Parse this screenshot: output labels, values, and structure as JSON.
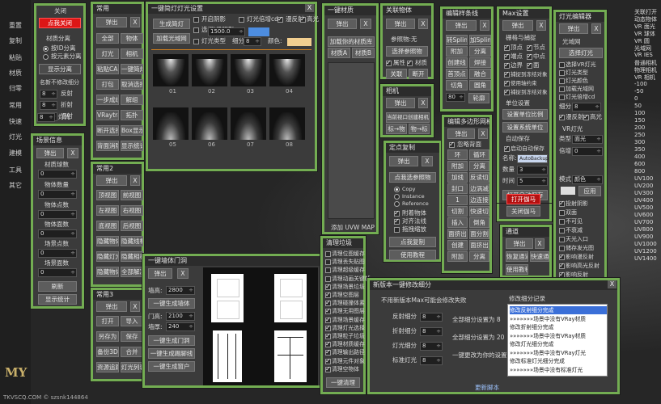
{
  "sidebar": {
    "items": [
      "重置",
      "复制",
      "粘贴",
      "材质",
      "归零",
      "常用",
      "快速",
      "灯光",
      "建模",
      "工具",
      "其它"
    ],
    "logo": "MY",
    "footer": "TKVSCQ.COM © szsnk144864"
  },
  "p_off": {
    "close": "关闭",
    "red": "点我关闭",
    "mat_sep": "材质分离",
    "r1": "按ID分离",
    "r2": "按元素分离",
    "s1": "显示分离",
    "rename": "名新不修改细分",
    "refl": "反射",
    "refr": "折射",
    "fx": "灯光",
    "fy": "漫射",
    "spins": [
      "8",
      "8",
      "8",
      "8"
    ]
  },
  "scene": {
    "title": "场景信息",
    "popup": "弹出",
    "labels": [
      "材质球数",
      "物体数量",
      "物体点数",
      "物体面数",
      "场景点数",
      "场景面数"
    ],
    "values": [
      "0",
      "0",
      "0",
      "0",
      "0",
      "0"
    ],
    "refresh": "刷新",
    "stats": "显示统计"
  },
  "common": {
    "title": "常用",
    "popup": "弹出",
    "btns": [
      "全部",
      "物体",
      "灯光",
      "相机",
      "粘贴CAD",
      "一键简灯",
      "打包",
      "取消选择",
      "一步成组",
      "解组",
      "VRaytrao",
      "拓扑",
      "断开选择",
      "Box显示",
      "背面消隐",
      "显示统计"
    ]
  },
  "common2": {
    "title": "常用2",
    "popup": "弹出",
    "btns": [
      "顶视图",
      "前视图",
      "左视图",
      "右视图",
      "底视图",
      "后视图",
      "隐藏物体",
      "隐藏线框",
      "隐藏灯光",
      "隐藏相机",
      "隐藏物体",
      "全部解冻"
    ]
  },
  "common3": {
    "title": "常用3",
    "popup": "弹出",
    "btns": [
      "打开",
      "导入",
      "另存为",
      "保存",
      "备份3D",
      "合并",
      "资源追踪",
      "灯光列表"
    ]
  },
  "light": {
    "title": "一键简灯灯光设置",
    "gen": "生成简灯",
    "load": "加载光域网",
    "c1": "开启阴影",
    "c2": "选择VR阴影",
    "c3": "灯光倍增cd",
    "c4": "漫反射",
    "c5": "高光",
    "intensity": "1500.0",
    "type": "灯光类型",
    "sub": "细分",
    "subval": "8",
    "color": "颜色:",
    "thumbs": [
      "01",
      "02",
      "03",
      "04",
      "05",
      "06",
      "07",
      "08"
    ]
  },
  "door": {
    "title": "一键墙体门洞",
    "popup": "弹出",
    "w": "墙高:",
    "wv": "2800",
    "gen": "一键生成墙体",
    "dh": "门高:",
    "dhv": "2100",
    "dt": "墙厚:",
    "dtv": "240",
    "b1": "一键生成门洞",
    "b2": "一键生成踢脚线",
    "b3": "一键生成窗户"
  },
  "mat": {
    "title": "一键材质",
    "popup": "弹出",
    "load": "加载你的材质库",
    "a": "材质A",
    "b": "材质B",
    "uvw": "添加 UVW MAP"
  },
  "link": {
    "title": "关联物体",
    "popup": "弹出",
    "ref": "参照物:无",
    "sel": "选择参照物",
    "c1": "属性",
    "c2": "材质",
    "rel": "关联",
    "brk": "断开"
  },
  "cam": {
    "title": "相机",
    "popup": "弹出",
    "cur": "当前视口创建相机",
    "tgt": "标→物",
    "obj": "物→标"
  },
  "copy": {
    "title": "定点复制",
    "popup": "弹出",
    "pick": "点我选参照物",
    "r1": "Copy",
    "r2": "Instance",
    "r3": "Reference",
    "c1": "附着物体",
    "c2": "对齐法线",
    "c3": "拖拽缩放",
    "paste": "点我复制",
    "guide": "使用教程"
  },
  "spline": {
    "title": "编辑样条线",
    "popup": "弹出",
    "b": [
      "转Spline",
      "加Spline",
      "附加",
      "分离",
      "创建线",
      "焊接",
      "首顶点",
      "融合",
      "切角",
      "圆角"
    ],
    "v1": "80",
    "contour": "轮廓"
  },
  "poly": {
    "title": "编辑多边形网格",
    "popup": "弹出",
    "c1": "忽略背面",
    "b": [
      "环",
      "循环",
      "附加",
      "分离",
      "加线",
      "反读切线",
      "封口",
      "边涡减",
      "1",
      "边连接",
      "切割",
      "快速切",
      "插入",
      "倒角",
      "面挤出",
      "面分割",
      "创建",
      "面挤出",
      "附加",
      "分离"
    ]
  },
  "max": {
    "title": "Max设置",
    "popup": "弹出",
    "grid": "栅格与捕捉",
    "c": [
      "顶点",
      "节点",
      "端点",
      "中点",
      "边界",
      "面"
    ],
    "c3": "捕捉到冻结对象",
    "c4": "使用轴约束",
    "c5": "捕捉到冻结对象",
    "unit": "单位设置",
    "unit1": "设置单位比例",
    "unit2": "设置系统单位",
    "save": "自动保存",
    "c6": "启动自动保存",
    "name": "名称:",
    "nameval": "AutoBackup",
    "cnt": "数量",
    "cntv": "3",
    "time": "时间",
    "timev": "5",
    "open": "打开自动保存",
    "gamma": "伽马",
    "g1": "打开伽马",
    "g2": "关闭伽马"
  },
  "lighted": {
    "title": "灯光编辑器",
    "popup": "弹出",
    "domain": "光域网",
    "b1": "选择灯光",
    "c": [
      "选择VR灯光",
      "灯光类型",
      "灯光颜色",
      "加载光域网",
      "灯光倍增cd"
    ],
    "sub": "细分",
    "subv": "8",
    "diff": "漫反射",
    "spec": "高光",
    "vr": "VR灯光",
    "type": "类型",
    "typev": "面光",
    "mul": "倍增",
    "mulv": "0",
    "mode": "模式",
    "modev": "颜色",
    "apply": "应用",
    "opts": [
      "投射阴影",
      "双面",
      "不可见",
      "不衰减",
      "天光入口",
      "储存发光图",
      "影响漫反射",
      "影响高光反射",
      "影响反射"
    ]
  },
  "channel": {
    "title": "通道",
    "popup": "弹出",
    "b1": "恢复通道",
    "b2": "快速通道",
    "b3": "使用教程"
  },
  "clean": {
    "title": "清理垃圾",
    "items": [
      "清理位图缓存",
      "清理丢失贴图",
      "清理超级缓存",
      "清理动画关键帧",
      "清理场景垃圾",
      "清理空图层",
      "清理碰撞体素",
      "清理无用图层",
      "清理场景缓存",
      "清理灯光选择",
      "清理粒子垃圾",
      "清理材质缓存",
      "清理输出路径",
      "清理元件对象",
      "清理空物体"
    ],
    "go": "一键清理"
  },
  "fix": {
    "title": "新版本一键修改细分",
    "hint": "不用新版本Max可能会修改失败",
    "r1": "反射细分",
    "r2": "折射细分",
    "r3": "灯光细分",
    "r4": "标准灯光",
    "v": [
      "8",
      "8",
      "8",
      "8"
    ],
    "b1": "全部细分设置为 8",
    "b2": "全部细分设置为 20",
    "b3": "一键更改为你的设置",
    "log": "修改细分记录",
    "logs": [
      "修改反射细分完成",
      "»»»»»»»场景中没有VRay材质",
      "修改折射细分完成",
      "»»»»»»»场景中没有VRay材质",
      "修改灯光细分完成",
      "»»»»»»»场景中没有VRay灯光",
      "修改标准灯光细分完成",
      "»»»»»»»场景中没有标准灯光"
    ],
    "bottom": "更新脚本"
  },
  "right": {
    "items": [
      "关联打开",
      "动态物体",
      "VR 面光",
      "VR 球体",
      "VR 圆",
      "光域网",
      "VR IES",
      "普通相机",
      "物理相机",
      "VR 相机",
      "-100",
      "-50",
      "0",
      "50",
      "100",
      "150",
      "200",
      "250",
      "300",
      "350",
      "400",
      "600",
      "800",
      "UV100",
      "UV200",
      "UV300",
      "UV400",
      "UV500",
      "UV600",
      "UV700",
      "UV800",
      "UV900",
      "UV1000",
      "UV1200",
      "UV1400"
    ]
  }
}
